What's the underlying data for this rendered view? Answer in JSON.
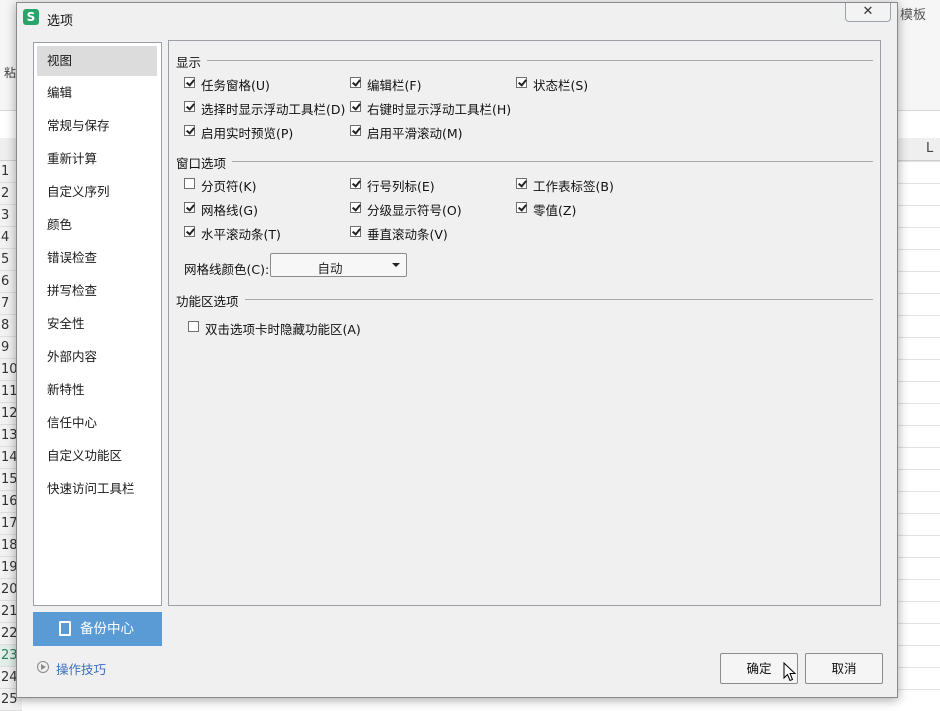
{
  "background": {
    "template_label": "模板",
    "paste_label": "粘",
    "column_label": "L",
    "rows": [
      "1",
      "2",
      "3",
      "4",
      "5",
      "6",
      "7",
      "8",
      "9",
      "10",
      "11",
      "12",
      "13",
      "14",
      "15",
      "16",
      "17",
      "18",
      "19",
      "20",
      "21",
      "22",
      "23",
      "24",
      "25"
    ],
    "selected_row": "23"
  },
  "dialog": {
    "title": "选项",
    "app_icon_letter": "S",
    "close_label": "✕",
    "nav": {
      "items": [
        "视图",
        "编辑",
        "常规与保存",
        "重新计算",
        "自定义序列",
        "颜色",
        "错误检查",
        "拼写检查",
        "安全性",
        "外部内容",
        "新特性",
        "信任中心",
        "自定义功能区",
        "快速访问工具栏"
      ],
      "active": "视图"
    },
    "backup_label": "备份中心",
    "tips_label": "操作技巧",
    "sections": {
      "display": {
        "title": "显示",
        "options": [
          {
            "label": "任务窗格(U)",
            "checked": true
          },
          {
            "label": "编辑栏(F)",
            "checked": true
          },
          {
            "label": "状态栏(S)",
            "checked": true
          },
          {
            "label": "选择时显示浮动工具栏(D)",
            "checked": true
          },
          {
            "label": "右键时显示浮动工具栏(H)",
            "checked": true
          },
          {
            "label": "启用实时预览(P)",
            "checked": true
          },
          {
            "label": "启用平滑滚动(M)",
            "checked": true
          }
        ]
      },
      "window": {
        "title": "窗口选项",
        "options": [
          {
            "label": "分页符(K)",
            "checked": false
          },
          {
            "label": "行号列标(E)",
            "checked": true
          },
          {
            "label": "工作表标签(B)",
            "checked": true
          },
          {
            "label": "网格线(G)",
            "checked": true
          },
          {
            "label": "分级显示符号(O)",
            "checked": true
          },
          {
            "label": "零值(Z)",
            "checked": true
          },
          {
            "label": "水平滚动条(T)",
            "checked": true
          },
          {
            "label": "垂直滚动条(V)",
            "checked": true
          }
        ],
        "grid_color_label": "网格线颜色(C):",
        "grid_color_value": "自动"
      },
      "ribbon": {
        "title": "功能区选项",
        "options": [
          {
            "label": "双击选项卡时隐藏功能区(A)",
            "checked": false
          }
        ]
      }
    },
    "ok_label": "确定",
    "cancel_label": "取消"
  },
  "colors": {
    "accent": "#5b9bd5",
    "link": "#3a6ec0",
    "app_icon": "#2aa46d"
  }
}
